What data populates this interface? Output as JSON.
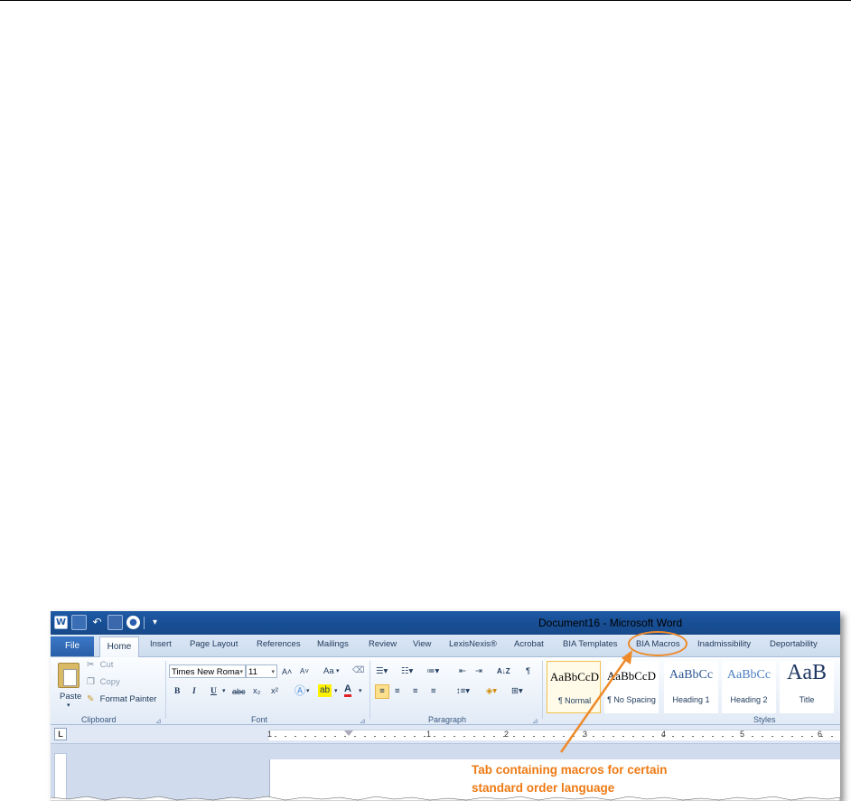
{
  "titlebar": {
    "title": "Document16 - Microsoft Word",
    "word_icon": "W",
    "customize_arrow": "▾"
  },
  "tabs": {
    "file": "File",
    "home": "Home",
    "items": [
      "Insert",
      "Page Layout",
      "References",
      "Mailings",
      "Review",
      "View",
      "LexisNexis®",
      "Acrobat",
      "BIA Templates",
      "BIA Macros",
      "Inadmissibility",
      "Deportability"
    ]
  },
  "clipboard": {
    "paste": "Paste",
    "cut": "Cut",
    "copy": "Copy",
    "format_painter": "Format Painter",
    "group_label": "Clipboard"
  },
  "font": {
    "name": "Times New Roma",
    "size": "11",
    "grow": "A˄",
    "shrink": "A˅",
    "case": "Aa",
    "bold": "B",
    "italic": "I",
    "underline": "U",
    "strikethrough": "abc",
    "subscript": "x₂",
    "superscript": "x²",
    "font_color": "A",
    "group_label": "Font"
  },
  "paragraph": {
    "sort": "A↓Z",
    "pilcrow": "¶",
    "group_label": "Paragraph"
  },
  "styles": {
    "items": [
      {
        "sample": "AaBbCcD",
        "name": "¶ Normal",
        "selected": true
      },
      {
        "sample": "AaBbCcD",
        "name": "¶ No Spacing",
        "selected": false
      },
      {
        "sample": "AaBbCc",
        "name": "Heading 1",
        "selected": false
      },
      {
        "sample": "AaBbCc",
        "name": "Heading 2",
        "selected": false
      },
      {
        "sample": "AaB",
        "name": "Title",
        "selected": false
      }
    ],
    "group_label": "Styles"
  },
  "ruler": {
    "tab_selector": "L",
    "numbers": [
      "1",
      "1",
      "2",
      "3",
      "4",
      "5",
      "6"
    ]
  },
  "annotation": {
    "line1": "Tab containing macros for certain",
    "line2": "standard order language",
    "color": "#ee7a14"
  },
  "colors": {
    "titlebar": "#1f5aa5",
    "ribbon_tab_bar": "#dce7f5",
    "file_tab": "#2a5ea8",
    "accent_orange": "#ee8a2a"
  }
}
